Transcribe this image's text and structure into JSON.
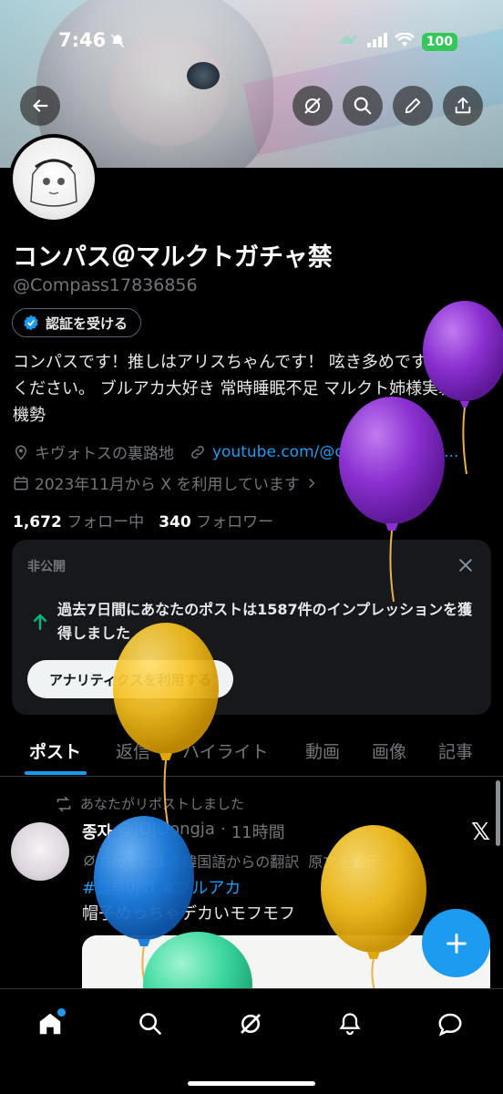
{
  "status_bar": {
    "time": "7:46",
    "battery": "100"
  },
  "profile": {
    "display_name": "コンパス＠マルクトガチャ禁",
    "handle": "@Compass17836856",
    "verify_label": "認証を受ける",
    "bio": "コンパスです！推しはアリスちゃんです！ 呟き多めです ご容赦ください。 ブルアカ大好き 常時睡眠不足 マルクト姉様実装待機勢",
    "location": "キヴォトスの裏路地",
    "link": "youtube.com/@conpass-l7d?s...",
    "joined": "2023年11月から X を利用しています",
    "following_count": "1,672",
    "following_label": "フォロー中",
    "followers_count": "340",
    "followers_label": "フォロワー"
  },
  "private_card": {
    "tag": "非公開",
    "message": "過去7日間にあなたのポストは1587件のインプレッションを獲得しました",
    "button": "アナリティクスを利用する"
  },
  "tabs": [
    "ポスト",
    "返信",
    "ハイライト",
    "動画",
    "画像",
    "記事"
  ],
  "post": {
    "repost_label": "あなたがリポストしました",
    "author": "종자",
    "handle": "@JOJOongja",
    "time": "11時間",
    "translate": "Grok による韓国語からの翻訳",
    "show_original": "原文を表示",
    "hashtag1": "#블루아카",
    "hashtag2": "#ブルアカ",
    "text": "帽子めっちゃデカいモフモフ"
  },
  "colors": {
    "accent": "#1d9bf0",
    "background": "#000000",
    "card": "#16181c",
    "muted": "#71767b"
  },
  "icons": [
    "back-icon",
    "grok-icon",
    "search-icon",
    "edit-icon",
    "share-icon",
    "location-icon",
    "link-icon",
    "calendar-icon",
    "close-icon",
    "up-arrow-icon",
    "repost-icon",
    "plus-icon",
    "home-icon",
    "notifications-icon",
    "messages-icon"
  ]
}
